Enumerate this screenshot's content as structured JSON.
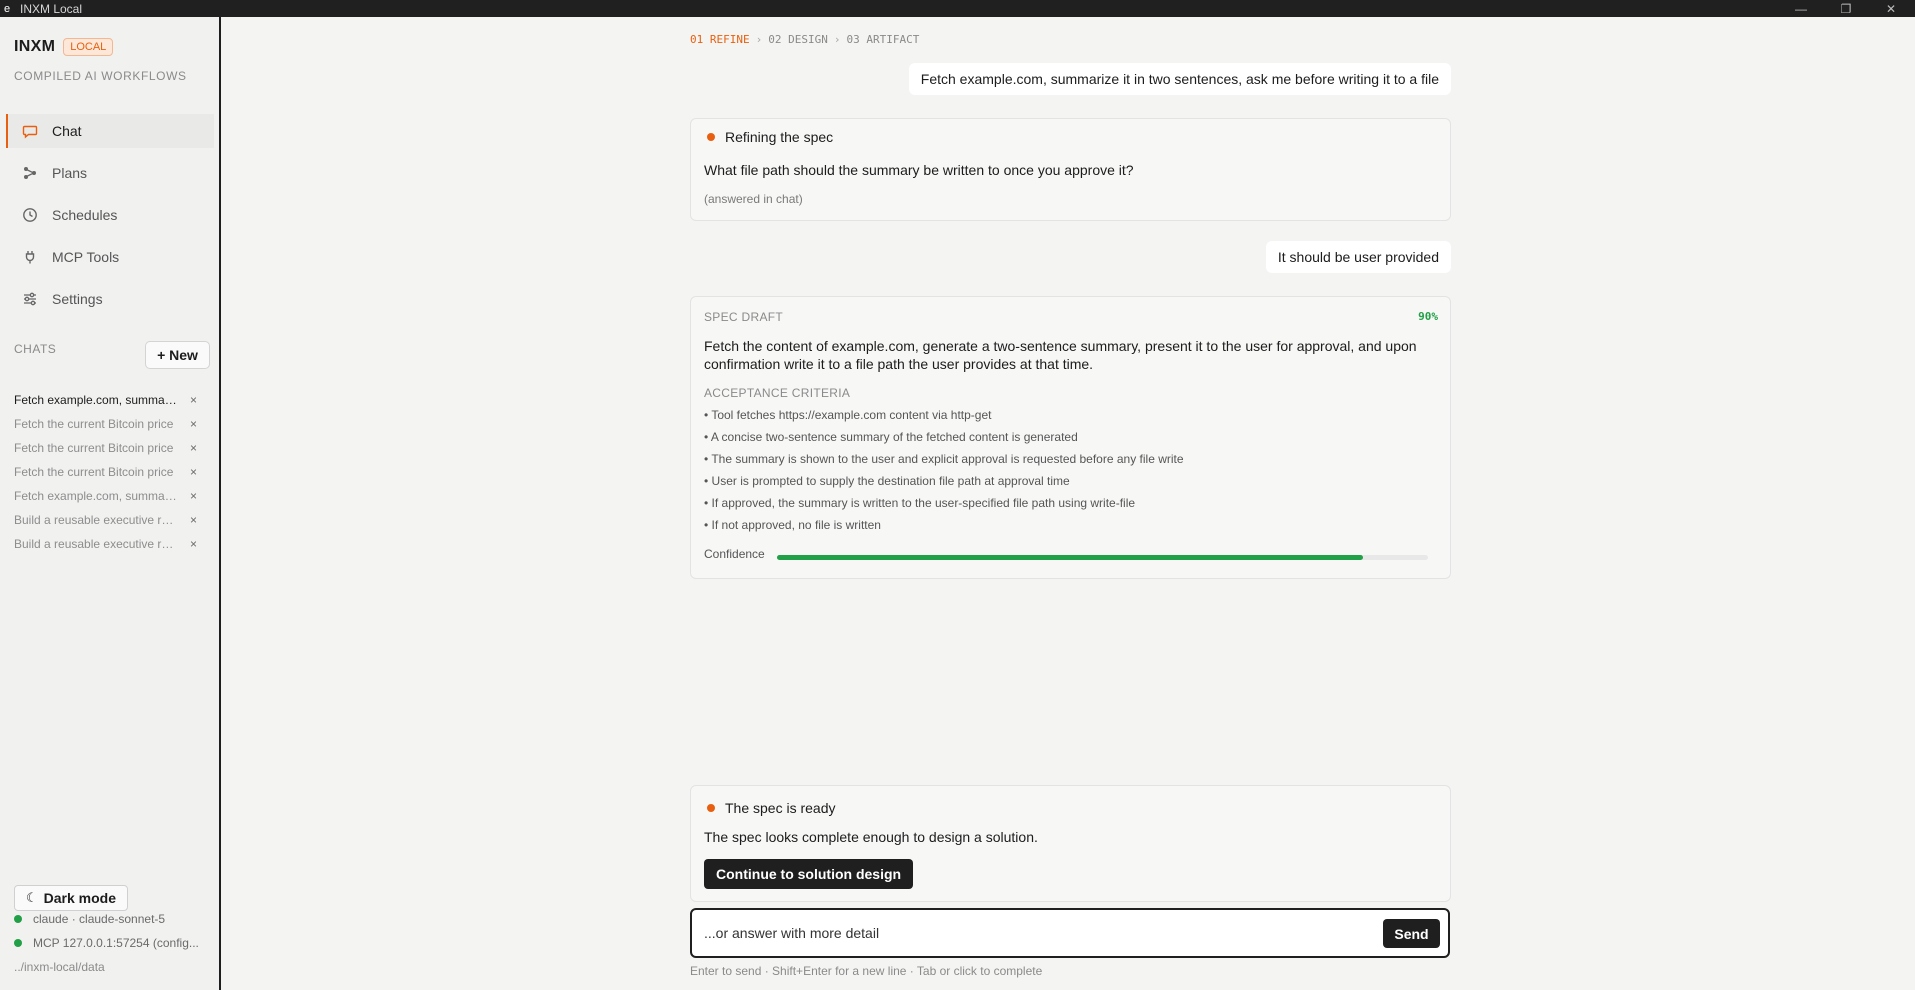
{
  "window": {
    "glyph": "e",
    "title": "INXM Local",
    "controls": [
      "minimize-icon",
      "restore-icon",
      "close-icon"
    ]
  },
  "sidebar": {
    "brand": "INXM",
    "badge": "LOCAL",
    "subtitle": "COMPILED AI WORKFLOWS",
    "nav": [
      {
        "label": "Chat",
        "icon": "chat-bubble-icon",
        "active": true
      },
      {
        "label": "Plans",
        "icon": "plans-graph-icon"
      },
      {
        "label": "Schedules",
        "icon": "clock-icon"
      },
      {
        "label": "MCP Tools",
        "icon": "plug-icon"
      },
      {
        "label": "Settings",
        "icon": "sliders-icon"
      }
    ],
    "chats_heading": "CHATS",
    "new_button": "+ New",
    "chats": [
      {
        "label": "Fetch example.com, summarize it in two sentences, ask me before writing it to a file",
        "active": true
      },
      {
        "label": "Fetch the current Bitcoin price"
      },
      {
        "label": "Fetch the current Bitcoin price"
      },
      {
        "label": "Fetch the current Bitcoin price"
      },
      {
        "label": "Fetch example.com, summarize it in two sentences"
      },
      {
        "label": "Build a reusable executive report"
      },
      {
        "label": "Build a reusable executive report"
      }
    ],
    "close_glyph": "×",
    "dark_mode": {
      "icon": "☾",
      "label": "Dark mode"
    },
    "status": [
      {
        "label": "claude · claude-sonnet-5",
        "color": "#22a047"
      },
      {
        "label": "MCP 127.0.0.1:57254 (config...",
        "color": "#22a047"
      }
    ],
    "data_path": "../inxm-local/data"
  },
  "main": {
    "steps": [
      {
        "label": "01 REFINE",
        "active": true
      },
      {
        "label": "02 DESIGN"
      },
      {
        "label": "03 ARTIFACT"
      }
    ],
    "step_separator": "›",
    "user_message_1": "Fetch example.com, summarize it in two sentences, ask me before writing it to a file",
    "refine_card": {
      "title": "Refining the spec",
      "question": "What file path should the summary be written to once you approve it?",
      "note": "(answered in chat)"
    },
    "user_message_2": "It should be user provided",
    "spec_draft": {
      "label": "SPEC DRAFT",
      "percent": "90%",
      "summary": "Fetch the content of example.com, generate a two-sentence summary, present it to the user for approval, and upon confirmation write it to a file path the user provides at that time.",
      "criteria_label": "ACCEPTANCE CRITERIA",
      "criteria": [
        "• Tool fetches https://example.com content via http-get",
        "• A concise two-sentence summary of the fetched content is generated",
        "• The summary is shown to the user and explicit approval is requested before any file write",
        "• User is prompted to supply the destination file path at approval time",
        "• If approved, the summary is written to the user-specified file path using write-file",
        "• If not approved, no file is written"
      ],
      "confidence_label": "Confidence",
      "confidence": 0.9
    },
    "ready_card": {
      "title": "The spec is ready",
      "text": "The spec looks complete enough to design a solution.",
      "button": "Continue to solution design"
    },
    "input": {
      "placeholder": "...or answer with more detail",
      "send": "Send"
    },
    "hint": "Enter to send · Shift+Enter for a new line · Tab or click to complete"
  },
  "colors": {
    "accent": "#e8600f",
    "success": "#22a047",
    "dark": "#1f1f1f"
  }
}
